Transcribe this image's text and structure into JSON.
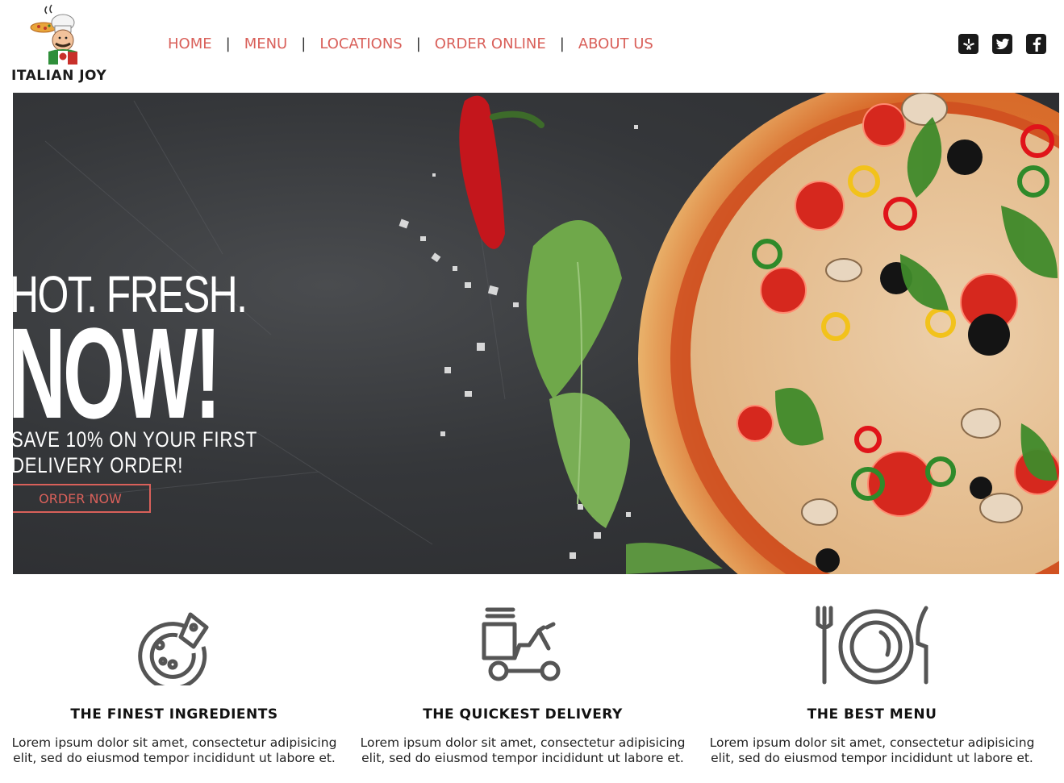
{
  "brand": {
    "name": "ITALIAN JOY"
  },
  "nav": {
    "items": [
      {
        "label": "HOME"
      },
      {
        "label": "MENU"
      },
      {
        "label": "LOCATIONS"
      },
      {
        "label": "ORDER ONLINE"
      },
      {
        "label": "ABOUT US"
      }
    ],
    "separator": "|"
  },
  "social": {
    "icons": [
      {
        "name": "yelp-icon",
        "glyph": "✻"
      },
      {
        "name": "twitter-icon",
        "glyph": "🐦"
      },
      {
        "name": "facebook-icon",
        "glyph": "f"
      }
    ]
  },
  "hero": {
    "line1": "HOT. FRESH.",
    "line2": "NOW!",
    "subtitle_line1": "SAVE 10% ON YOUR FIRST",
    "subtitle_line2": "DELIVERY ORDER!",
    "cta_label": "ORDER NOW"
  },
  "features": [
    {
      "icon": "pizza-icon",
      "title": "THE FINEST INGREDIENTS",
      "text": "Lorem ipsum dolor sit amet, consectetur adipisicing elit, sed do eiusmod tempor incididunt ut labore et."
    },
    {
      "icon": "delivery-scooter-icon",
      "title": "THE QUICKEST DELIVERY",
      "text": "Lorem ipsum dolor sit amet, consectetur adipisicing elit, sed do eiusmod tempor incididunt ut labore et."
    },
    {
      "icon": "plate-cutlery-icon",
      "title": "THE BEST MENU",
      "text": "Lorem ipsum dolor sit amet, consectetur adipisicing elit, sed do eiusmod tempor incididunt ut labore et."
    }
  ],
  "colors": {
    "accent": "#d9605a",
    "hero_bg": "#35373a",
    "icon_gray": "#555555",
    "text_dark": "#111111"
  }
}
